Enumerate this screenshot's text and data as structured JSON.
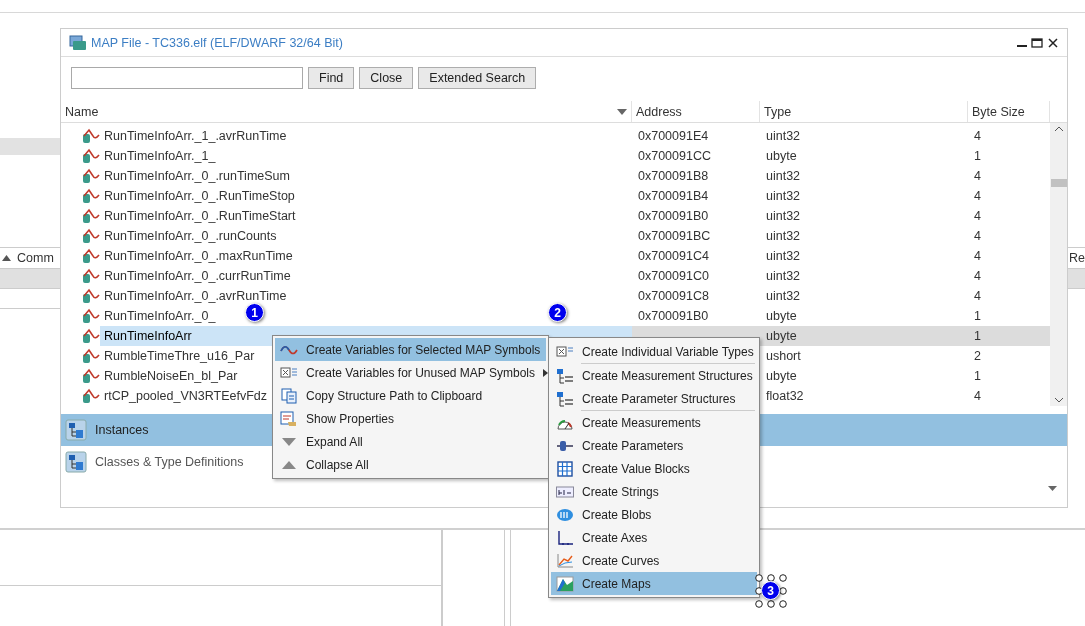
{
  "background": {
    "left_header": "Comm",
    "right_header": "Re"
  },
  "window": {
    "title": "MAP File - TC336.elf (ELF/DWARF 32/64 Bit)"
  },
  "toolbar": {
    "buttons": [
      "Find",
      "Close",
      "Extended Search"
    ]
  },
  "table": {
    "columns": [
      "Name",
      "Address",
      "Type",
      "Byte Size"
    ],
    "rows": [
      {
        "name": "RunTimeInfoArr._1_.avrRunTime",
        "address": "0x700091E4",
        "type": "uint32",
        "byte_size": "4",
        "selected": false
      },
      {
        "name": "RunTimeInfoArr._1_",
        "address": "0x700091CC",
        "type": "ubyte",
        "byte_size": "1",
        "selected": false
      },
      {
        "name": "RunTimeInfoArr._0_.runTimeSum",
        "address": "0x700091B8",
        "type": "uint32",
        "byte_size": "4",
        "selected": false
      },
      {
        "name": "RunTimeInfoArr._0_.RunTimeStop",
        "address": "0x700091B4",
        "type": "uint32",
        "byte_size": "4",
        "selected": false
      },
      {
        "name": "RunTimeInfoArr._0_.RunTimeStart",
        "address": "0x700091B0",
        "type": "uint32",
        "byte_size": "4",
        "selected": false
      },
      {
        "name": "RunTimeInfoArr._0_.runCounts",
        "address": "0x700091BC",
        "type": "uint32",
        "byte_size": "4",
        "selected": false
      },
      {
        "name": "RunTimeInfoArr._0_.maxRunTime",
        "address": "0x700091C4",
        "type": "uint32",
        "byte_size": "4",
        "selected": false
      },
      {
        "name": "RunTimeInfoArr._0_.currRunTime",
        "address": "0x700091C0",
        "type": "uint32",
        "byte_size": "4",
        "selected": false
      },
      {
        "name": "RunTimeInfoArr._0_.avrRunTime",
        "address": "0x700091C8",
        "type": "uint32",
        "byte_size": "4",
        "selected": false
      },
      {
        "name": "RunTimeInfoArr._0_",
        "address": "0x700091B0",
        "type": "ubyte",
        "byte_size": "1",
        "selected": false
      },
      {
        "name": "RunTimeInfoArr",
        "address": "",
        "type": "ubyte",
        "byte_size": "1",
        "selected": true
      },
      {
        "name": "RumbleTimeThre_u16_Par",
        "address": "",
        "type": "ushort",
        "byte_size": "2",
        "selected": false
      },
      {
        "name": "RumbleNoiseEn_bl_Par",
        "address": "",
        "type": "ubyte",
        "byte_size": "1",
        "selected": false
      },
      {
        "name": "rtCP_pooled_VN3RTEefvFdz",
        "address": "",
        "type": "float32",
        "byte_size": "4",
        "selected": false
      }
    ]
  },
  "panel_tabs": [
    {
      "label": "Instances",
      "selected": true
    },
    {
      "label": "Classes & Type Definitions",
      "selected": false
    }
  ],
  "context_menu": [
    {
      "label": "Create Variables for Selected MAP Symbols",
      "selected": true,
      "has_submenu": true
    },
    {
      "label": "Create Variables for Unused MAP Symbols",
      "selected": false,
      "has_submenu": true
    },
    {
      "label": "Copy Structure Path to Clipboard",
      "selected": false,
      "has_submenu": false
    },
    {
      "label": "Show Properties",
      "selected": false,
      "has_submenu": false
    },
    {
      "label": "Expand All",
      "selected": false,
      "has_submenu": false
    },
    {
      "label": "Collapse All",
      "selected": false,
      "has_submenu": false
    }
  ],
  "submenu": [
    {
      "label": "Create Individual Variable Types",
      "selected": false,
      "separator_before": false
    },
    {
      "label": "Create Measurement Structures",
      "selected": false,
      "separator_before": true
    },
    {
      "label": "Create Parameter Structures",
      "selected": false,
      "separator_before": false
    },
    {
      "label": "Create Measurements",
      "selected": false,
      "separator_before": true
    },
    {
      "label": "Create Parameters",
      "selected": false,
      "separator_before": false
    },
    {
      "label": "Create Value Blocks",
      "selected": false,
      "separator_before": false
    },
    {
      "label": "Create Strings",
      "selected": false,
      "separator_before": false
    },
    {
      "label": "Create Blobs",
      "selected": false,
      "separator_before": false
    },
    {
      "label": "Create Axes",
      "selected": false,
      "separator_before": false
    },
    {
      "label": "Create Curves",
      "selected": false,
      "separator_before": false
    },
    {
      "label": "Create Maps",
      "selected": true,
      "separator_before": false
    }
  ],
  "markers": [
    "1",
    "2",
    "3"
  ]
}
